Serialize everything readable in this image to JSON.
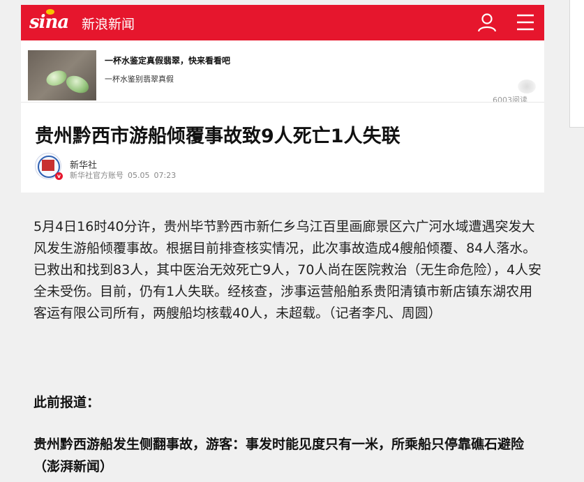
{
  "header": {
    "logo_text": "sina",
    "site_name": "新浪新闻",
    "icons": [
      "user-icon",
      "menu-icon"
    ],
    "brand_color": "#e6162d"
  },
  "ad": {
    "title": "一杯水鉴定真假翡翠，快来看看吧",
    "subtitle": "一杯水鉴别翡翠真假",
    "reads": "6003阅读"
  },
  "article": {
    "title": "贵州黔西市游船倾覆事故致9人死亡1人失联",
    "author": {
      "name": "新华社",
      "account": "新华社官方账号",
      "date": "05.05",
      "time": "07:23",
      "badge": "v"
    },
    "body": "5月4日16时40分许，贵州毕节黔西市新仁乡乌江百里画廊景区六广河水域遭遇突发大风发生游船倾覆事故。根据目前排查核实情况，此次事故造成4艘船倾覆、84人落水。已救出和找到83人，其中医治无效死亡9人，70人尚在医院救治（无生命危险），4人安全未受伤。目前，仍有1人失联。经核查，涉事运营船舶系贵阳清镇市新店镇东湖农用客运有限公司所有，两艘船均核载40人，未超载。（记者李凡、周圆）",
    "previous_label": "此前报道：",
    "related_title": "贵州黔西游船发生侧翻事故，游客：事发时能见度只有一米，所乘船只停靠礁石避险（澎湃新闻）"
  }
}
